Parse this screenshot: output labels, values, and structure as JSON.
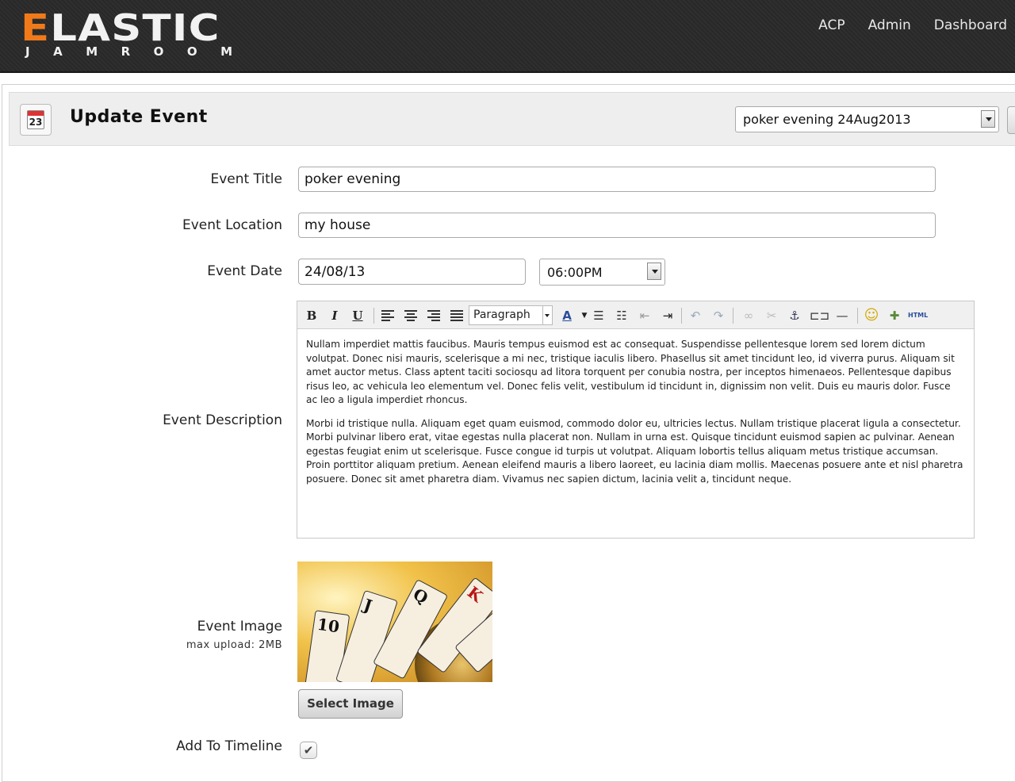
{
  "header": {
    "logo_main": "ELASTIC",
    "logo_sub": "JAMROOM",
    "nav": [
      "ACP",
      "Admin",
      "Dashboard"
    ]
  },
  "title_bar": {
    "icon_day": "23",
    "title": "Update Event",
    "event_select_value": "poker evening 24Aug2013"
  },
  "form": {
    "event_title_label": "Event Title",
    "event_title_value": "poker evening",
    "event_location_label": "Event Location",
    "event_location_value": "my house",
    "event_date_label": "Event Date",
    "event_date_value": "24/08/13",
    "event_time_value": "06:00PM",
    "event_description_label": "Event Description",
    "editor": {
      "format_select": "Paragraph",
      "html_button": "HTML",
      "paragraphs": [
        "Nullam imperdiet mattis faucibus. Mauris tempus euismod est ac consequat. Suspendisse pellentesque lorem sed lorem dictum volutpat. Donec nisi mauris, scelerisque a mi nec, tristique iaculis libero. Phasellus sit amet tincidunt leo, id viverra purus. Aliquam sit amet auctor metus. Class aptent taciti sociosqu ad litora torquent per conubia nostra, per inceptos himenaeos. Pellentesque dapibus risus leo, ac vehicula leo elementum vel. Donec felis velit, vestibulum id tincidunt in, dignissim non velit. Duis eu mauris dolor. Fusce ac leo a ligula imperdiet rhoncus.",
        "Morbi id tristique nulla. Aliquam eget quam euismod, commodo dolor eu, ultricies lectus. Nullam tristique placerat ligula a consectetur. Morbi pulvinar libero erat, vitae egestas nulla placerat non. Nullam in urna est. Quisque tincidunt euismod sapien ac pulvinar. Aenean egestas feugiat enim ut scelerisque. Fusce congue id turpis ut volutpat. Aliquam lobortis tellus aliquam metus tristique accumsan. Proin porttitor aliquam pretium. Aenean eleifend mauris a libero laoreet, eu lacinia diam mollis. Maecenas posuere ante et nisl pharetra posuere. Donec sit amet pharetra diam. Vivamus nec sapien dictum, lacinia velit a, tincidunt neque."
      ]
    },
    "event_image_label": "Event Image",
    "event_image_sublabel": "max upload: 2MB",
    "select_image_button": "Select Image",
    "add_to_timeline_label": "Add To Timeline",
    "add_to_timeline_checked": true
  },
  "colors": {
    "header_bg": "#2a2a2a",
    "logo_accent": "#f07a1a"
  }
}
